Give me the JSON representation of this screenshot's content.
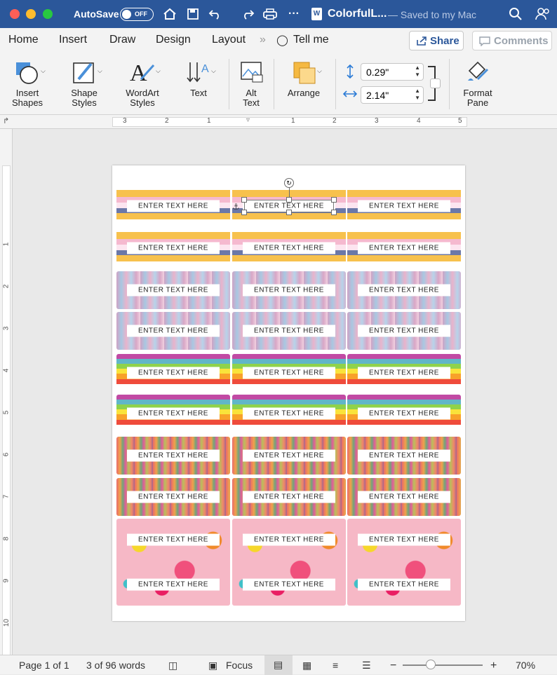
{
  "window": {
    "autosave_label": "AutoSave",
    "autosave_state": "OFF",
    "doc_title": "ColorfulL...",
    "doc_status": "— Saved to my Mac",
    "icons": [
      "home-icon",
      "save-icon",
      "undo-icon",
      "redo-icon",
      "print-icon",
      "more-icon",
      "search-icon",
      "share-people-icon"
    ]
  },
  "menu": {
    "tabs": [
      "Home",
      "Insert",
      "Draw",
      "Design",
      "Layout",
      "»",
      "Tell me"
    ],
    "share": "Share",
    "comments": "Comments"
  },
  "ribbon": {
    "buttons": [
      {
        "name": "insert-shapes",
        "line1": "Insert",
        "line2": "Shapes"
      },
      {
        "name": "shape-styles",
        "line1": "Shape",
        "line2": "Styles"
      },
      {
        "name": "wordart-styles",
        "line1": "WordArt",
        "line2": "Styles"
      },
      {
        "name": "text",
        "line1": "Text",
        "line2": ""
      },
      {
        "name": "alt-text",
        "line1": "Alt",
        "line2": "Text"
      },
      {
        "name": "arrange",
        "line1": "Arrange",
        "line2": ""
      },
      {
        "name": "format-pane",
        "line1": "Format",
        "line2": "Pane"
      }
    ],
    "height_value": "0.29\"",
    "width_value": "2.14\""
  },
  "ruler": {
    "h_numbers": [
      "3",
      "2",
      "1",
      "1",
      "2",
      "3",
      "4",
      "5"
    ],
    "v_numbers": [
      "1",
      "2",
      "3",
      "4",
      "5",
      "6",
      "7",
      "8",
      "9",
      "10"
    ]
  },
  "labels": {
    "text": "ENTER TEXT HERE",
    "rows": [
      {
        "style": "yellow-scallop"
      },
      {
        "style": "yellow-scallop"
      },
      {
        "style": "watercolor"
      },
      {
        "style": "watercolor"
      },
      {
        "style": "rainbow"
      },
      {
        "style": "rainbow"
      },
      {
        "style": "brushstroke"
      },
      {
        "style": "brushstroke"
      },
      {
        "style": "floral",
        "tall": true
      }
    ]
  },
  "status": {
    "page": "Page 1 of 1",
    "words": "3 of 96 words",
    "focus": "Focus",
    "zoom": "70%",
    "zoom_level": 0.35
  }
}
